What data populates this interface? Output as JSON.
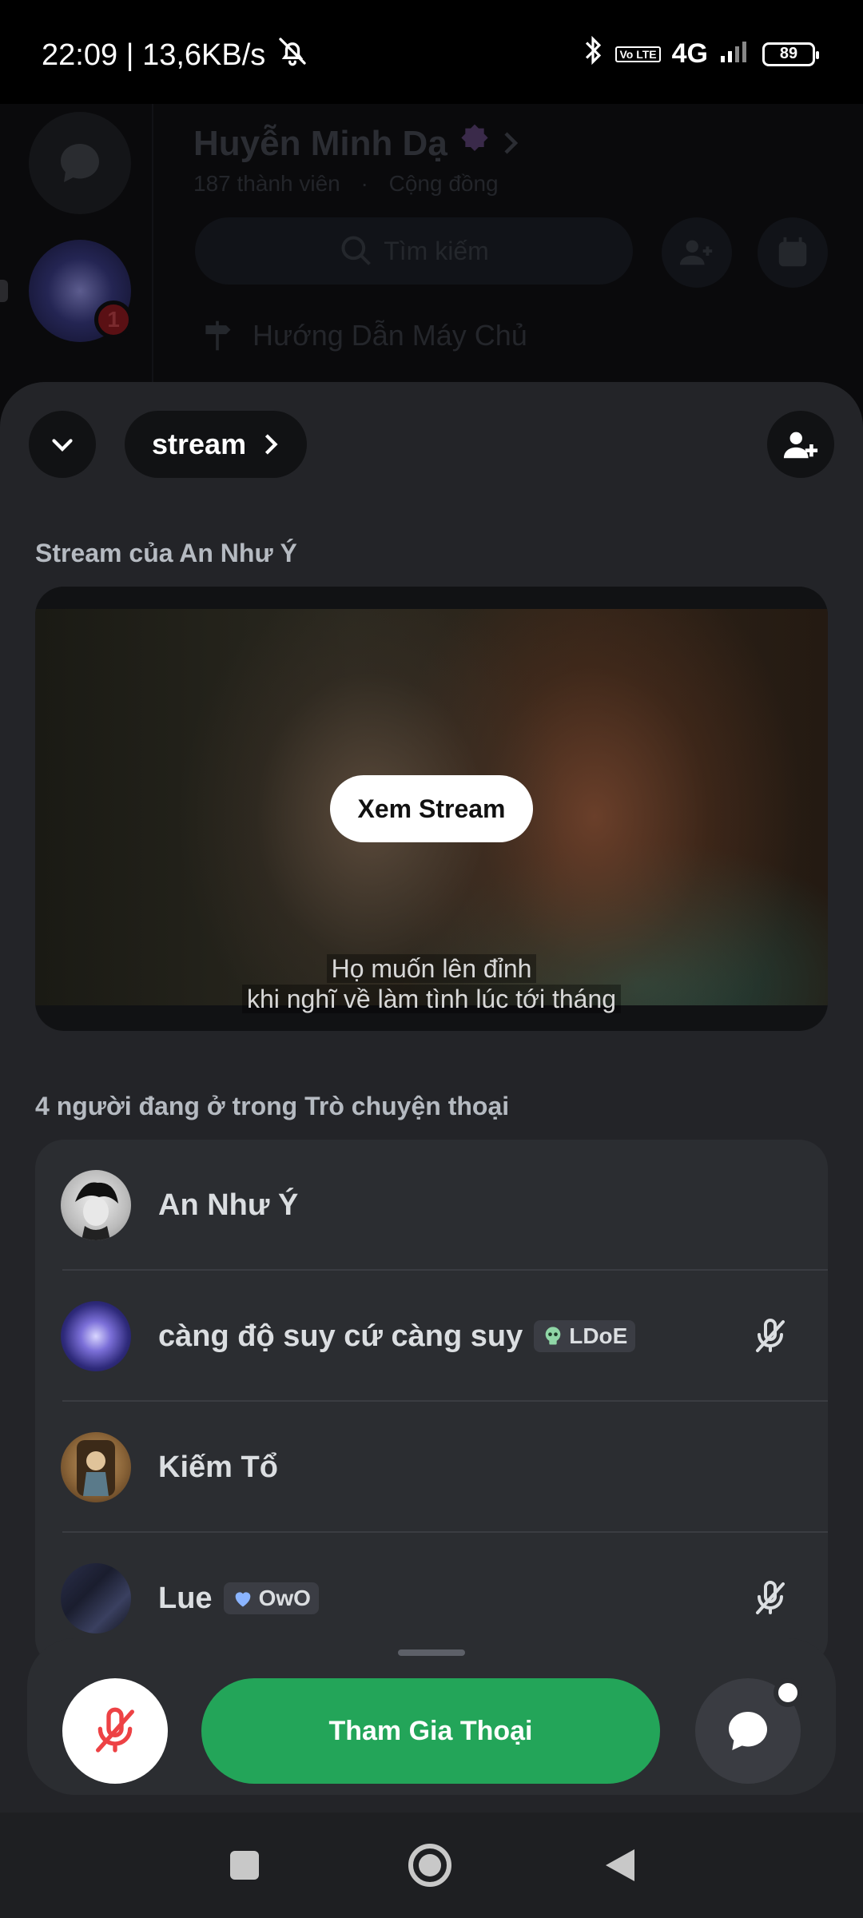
{
  "status_bar": {
    "time_speed": "22:09 | 13,6KB/s",
    "network": "4G",
    "volte": "Vo LTE",
    "battery": "89"
  },
  "background": {
    "server_name": "Huyễn Minh Dạ",
    "member_count": "187 thành viên",
    "community_label": "Cộng đồng",
    "search_placeholder": "Tìm kiếm",
    "guide_label": "Hướng Dẫn Máy Chủ",
    "badge_count": "1"
  },
  "sheet": {
    "channel_name": "stream",
    "stream_section_label": "Stream của An Như Ý",
    "watch_button": "Xem Stream",
    "subtitle_line1": "Họ muốn lên đỉnh",
    "subtitle_line2": "khi nghĩ về làm tình lúc tới tháng",
    "participants_label": "4 người đang ở trong Trò chuyện thoại",
    "participants": [
      {
        "name": "An Như Ý",
        "tag": "",
        "muted": false
      },
      {
        "name": "càng độ suy cứ càng suy",
        "tag": "LDoE",
        "muted": true
      },
      {
        "name": "Kiếm Tổ",
        "tag": "",
        "muted": false
      },
      {
        "name": "Lue",
        "tag": "OwO",
        "muted": true
      }
    ],
    "join_button": "Tham Gia Thoại"
  },
  "colors": {
    "sheet_bg": "#232428",
    "card_bg": "#2b2d31",
    "join_green": "#23a559",
    "mute_red": "#ed4245"
  }
}
